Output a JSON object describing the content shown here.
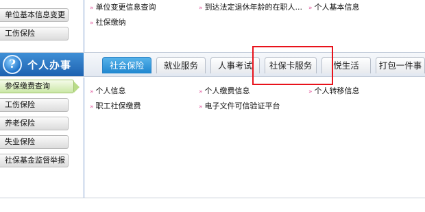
{
  "top": {
    "sidebar": [
      "单位基本信息变更",
      "工伤保险"
    ],
    "links": [
      "单位变更信息查询",
      "到达法定退休年龄的在职人...",
      "个人基本信息",
      "社保缴纳"
    ]
  },
  "section": {
    "title": "个人办事",
    "help_glyph": "?",
    "tabs": [
      "社会保险",
      "就业服务",
      "人事考试",
      "社保卡服务",
      "悦生活",
      "打包一件事"
    ],
    "active_tab": "社会保险"
  },
  "sidebar": [
    "参保缴费查询",
    "工伤保险",
    "养老保险",
    "失业保险",
    "社保基金监督举报"
  ],
  "links": [
    "个人信息",
    "个人缴费信息",
    "个人转移信息",
    "职工社保缴费",
    "电子文件可信验证平台"
  ],
  "arrow_glyph": "»",
  "highlight_color": "#e8121b",
  "accent_color": "#1f86cf"
}
